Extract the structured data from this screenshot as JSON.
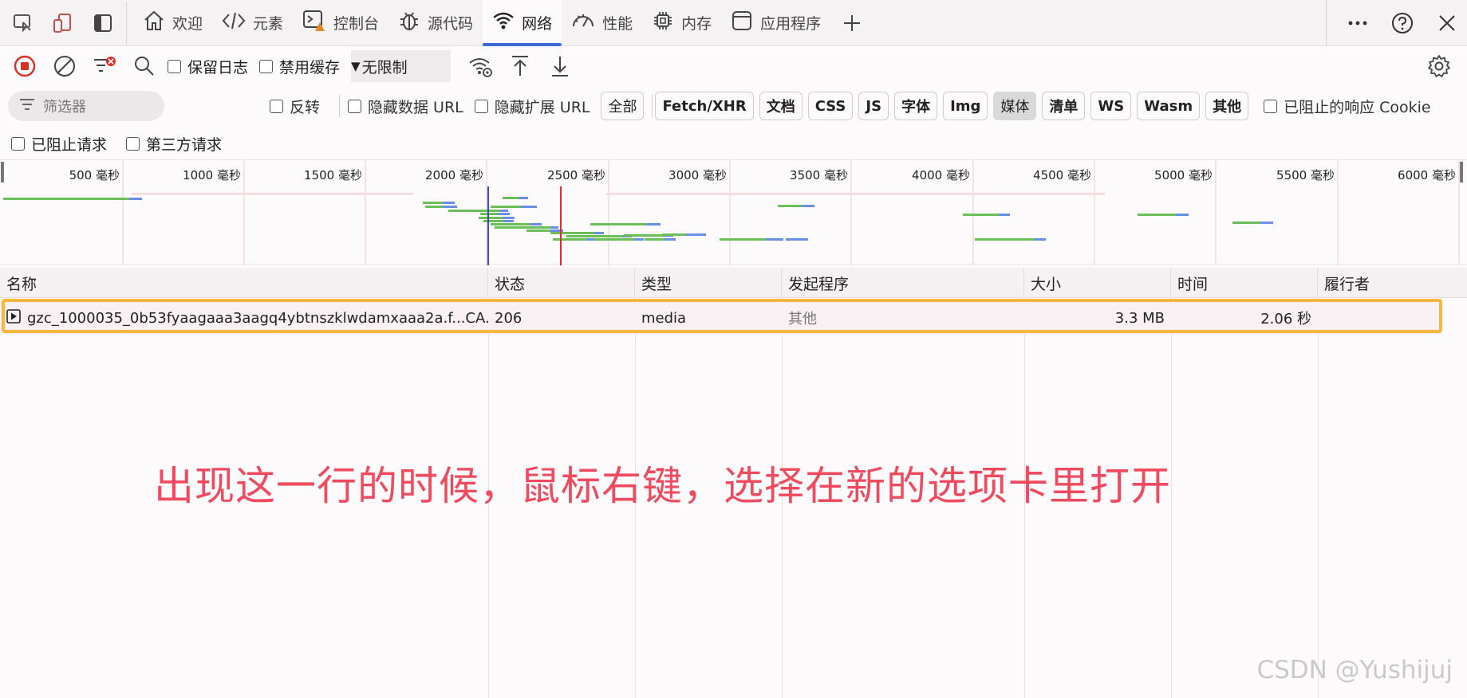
{
  "tabbar": {
    "tabs": [
      {
        "label": "欢迎",
        "icon": "home-icon"
      },
      {
        "label": "元素",
        "icon": "code-icon"
      },
      {
        "label": "控制台",
        "icon": "console-icon"
      },
      {
        "label": "源代码",
        "icon": "bug-icon"
      },
      {
        "label": "网络",
        "icon": "wifi-icon",
        "active": true
      },
      {
        "label": "性能",
        "icon": "gauge-icon"
      },
      {
        "label": "内存",
        "icon": "chip-icon"
      },
      {
        "label": "应用程序",
        "icon": "app-window-icon"
      }
    ]
  },
  "toolbar": {
    "preserve_log": "保留日志",
    "disable_cache": "禁用缓存",
    "throttle": "无限制"
  },
  "filter": {
    "placeholder": "筛选器",
    "invert": "反转",
    "hide_data_url": "隐藏数据 URL",
    "hide_ext_url": "隐藏扩展 URL",
    "types": [
      "全部",
      "Fetch/XHR",
      "文档",
      "CSS",
      "JS",
      "字体",
      "Img",
      "媒体",
      "清单",
      "WS",
      "Wasm",
      "其他"
    ],
    "active_type": "媒体",
    "blocked_cookies": "已阻止的响应 Cookie",
    "blocked_requests": "已阻止请求",
    "third_party": "第三方请求"
  },
  "overview": {
    "ticks": [
      "500 毫秒",
      "1000 毫秒",
      "1500 毫秒",
      "2000 毫秒",
      "2500 毫秒",
      "3000 毫秒",
      "3500 毫秒",
      "4000 毫秒",
      "4500 毫秒",
      "5000 毫秒",
      "5500 毫秒",
      "6000 毫秒"
    ]
  },
  "table": {
    "headers": [
      "名称",
      "状态",
      "类型",
      "发起程序",
      "大小",
      "时间",
      "履行者"
    ],
    "rows": [
      {
        "name": "gzc_1000035_0b53fyaagaaa3aagq4ybtnszklwdamxaaa2a.f...CA...",
        "status": "206",
        "type": "media",
        "initiator": "其他",
        "size": "3.3 MB",
        "time": "2.06 秒",
        "fulfilled_by": ""
      }
    ]
  },
  "annotation": "出现这一行的时候，鼠标右键，选择在新的选项卡里打开",
  "watermark": "CSDN @Yushijuj"
}
